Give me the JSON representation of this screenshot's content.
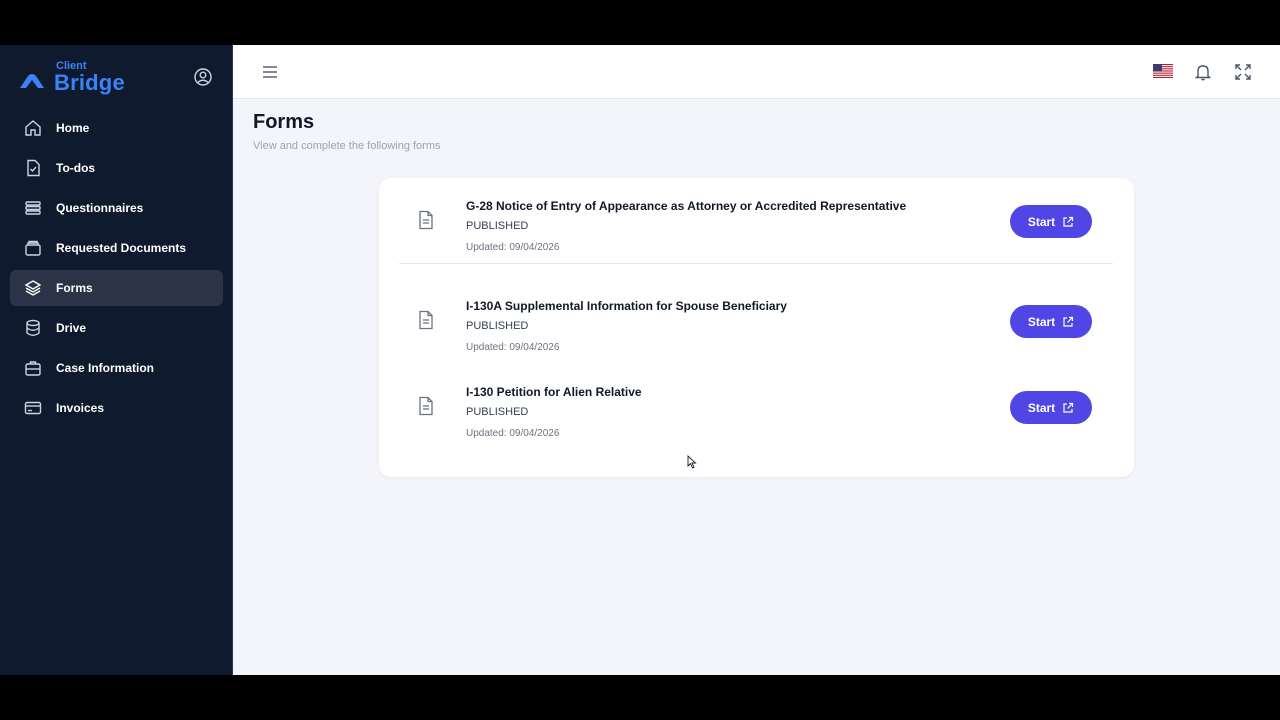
{
  "brand": {
    "small": "Client",
    "big": "Bridge",
    "color": "#3b82f6"
  },
  "sidebar": {
    "items": [
      {
        "label": "Home",
        "icon": "home-icon",
        "active": false
      },
      {
        "label": "To-dos",
        "icon": "checklist-icon",
        "active": false
      },
      {
        "label": "Questionnaires",
        "icon": "list-icon",
        "active": false
      },
      {
        "label": "Requested Documents",
        "icon": "folder-icon",
        "active": false
      },
      {
        "label": "Forms",
        "icon": "layers-icon",
        "active": true
      },
      {
        "label": "Drive",
        "icon": "database-icon",
        "active": false
      },
      {
        "label": "Case Information",
        "icon": "briefcase-icon",
        "active": false
      },
      {
        "label": "Invoices",
        "icon": "credit-card-icon",
        "active": false
      }
    ]
  },
  "header": {
    "icons": [
      "menu-icon",
      "us-flag-icon",
      "bell-icon",
      "fullscreen-icon"
    ]
  },
  "page": {
    "title": "Forms",
    "subtitle": "View and complete the following forms"
  },
  "forms": [
    {
      "title": "G-28 Notice of Entry of Appearance as Attorney or Accredited Representative",
      "status": "PUBLISHED",
      "updated": "Updated: 09/04/2026",
      "button": "Start"
    },
    {
      "title": "I-130A Supplemental Information for Spouse Beneficiary",
      "status": "PUBLISHED",
      "updated": "Updated: 09/04/2026",
      "button": "Start"
    },
    {
      "title": "I-130 Petition for Alien Relative",
      "status": "PUBLISHED",
      "updated": "Updated: 09/04/2026",
      "button": "Start"
    }
  ],
  "colors": {
    "sidebar_bg": "#0f1a2e",
    "active_item": "#2b3446",
    "accent": "#4f46e5",
    "page_bg": "#f3f5fb"
  }
}
